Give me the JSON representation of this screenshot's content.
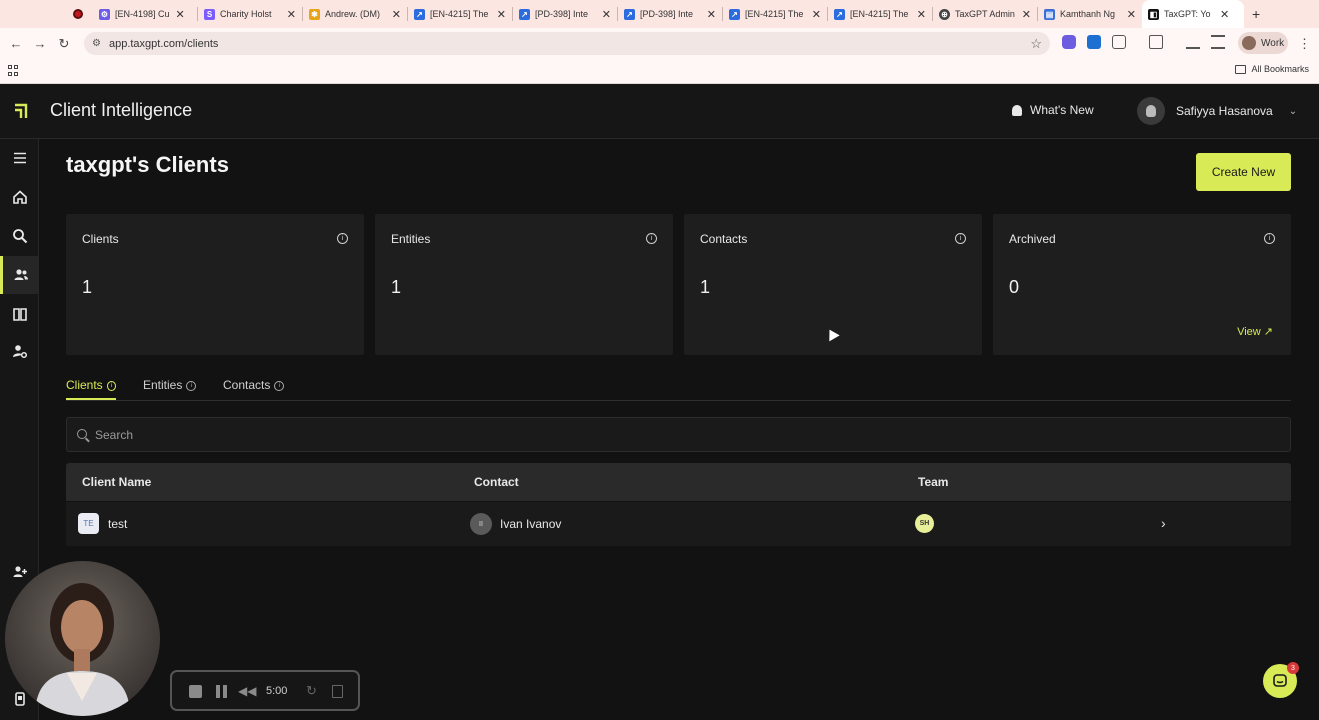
{
  "browser": {
    "tabs": [
      {
        "title": "[EN-4198] Cu",
        "fav_color": "#6c5ce7"
      },
      {
        "title": "Charity Holst",
        "fav_color": "#7b5cff"
      },
      {
        "title": "Andrew. (DM)",
        "fav_color": "#e8a317"
      },
      {
        "title": "[EN-4215] The",
        "fav_color": "#2d6cdf"
      },
      {
        "title": "[PD-398] Inte",
        "fav_color": "#2d6cdf"
      },
      {
        "title": "[PD-398] Inte",
        "fav_color": "#2d6cdf"
      },
      {
        "title": "[EN-4215] The",
        "fav_color": "#2d6cdf"
      },
      {
        "title": "[EN-4215] The",
        "fav_color": "#2d6cdf"
      },
      {
        "title": "TaxGPT Admin",
        "fav_color": "#444444"
      },
      {
        "title": "Kamthanh Ng",
        "fav_color": "#3a6fd8"
      },
      {
        "title": "TaxGPT: Yo",
        "fav_color": "#111111"
      }
    ],
    "url": "app.taxgpt.com/clients",
    "profile_label": "Work",
    "all_bookmarks": "All Bookmarks"
  },
  "header": {
    "app_title": "Client Intelligence",
    "whats_new": "What's New",
    "user_name": "Safiyya Hasanova"
  },
  "page": {
    "title": "taxgpt's Clients",
    "create_button": "Create New"
  },
  "stats": [
    {
      "label": "Clients",
      "value": "1"
    },
    {
      "label": "Entities",
      "value": "1"
    },
    {
      "label": "Contacts",
      "value": "1"
    },
    {
      "label": "Archived",
      "value": "0",
      "link": "View ↗"
    }
  ],
  "tabs": [
    {
      "label": "Clients",
      "active": true
    },
    {
      "label": "Entities",
      "active": false
    },
    {
      "label": "Contacts",
      "active": false
    }
  ],
  "search": {
    "placeholder": "Search"
  },
  "table": {
    "headers": {
      "client_name": "Client Name",
      "contact": "Contact",
      "team": "Team"
    },
    "rows": [
      {
        "badge": "TE",
        "client_name": "test",
        "contact_initials": "II",
        "contact": "Ivan Ivanov",
        "team_initials": "SH"
      }
    ]
  },
  "recorder": {
    "time": "5:00"
  },
  "chat": {
    "unread": "3"
  },
  "colors": {
    "accent": "#d8ea55",
    "background": "#121212"
  }
}
